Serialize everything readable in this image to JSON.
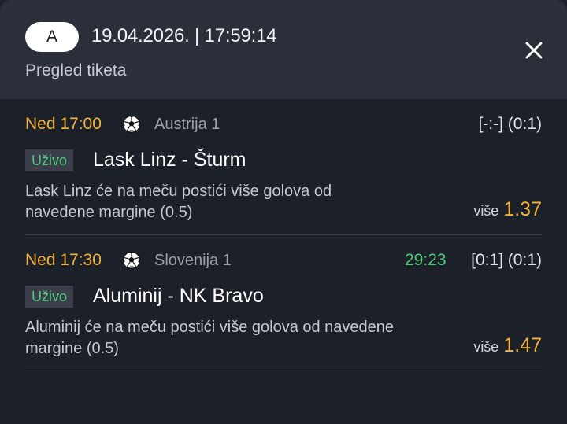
{
  "header": {
    "badge": "A",
    "datetime": "19.04.2026. | 17:59:14",
    "subtitle": "Pregled tiketa",
    "close_icon": "close-icon"
  },
  "tickets": [
    {
      "time": "Ned 17:00",
      "sport_icon": "soccer-ball-icon",
      "league": "Austrija 1",
      "minute": "",
      "score": "[-:-] (0:1)",
      "status": "Uživo",
      "match": "Lask Linz - Šturm",
      "description": "Lask Linz će na meču postići više golova od navedene margine (0.5)",
      "pick_label": "više",
      "odds": "1.37"
    },
    {
      "time": "Ned 17:30",
      "sport_icon": "soccer-ball-icon",
      "league": "Slovenija 1",
      "minute": "29:23",
      "score": "[0:1] (0:1)",
      "status": "Uživo",
      "match": "Aluminij - NK Bravo",
      "description": "Aluminij će na meču postići više golova od navedene margine (0.5)",
      "pick_label": "više",
      "odds": "1.47"
    }
  ],
  "colors": {
    "accent_orange": "#f2b33a",
    "live_green": "#4fc97a",
    "background": "#1c2029",
    "header_background": "#2a2f3a"
  }
}
